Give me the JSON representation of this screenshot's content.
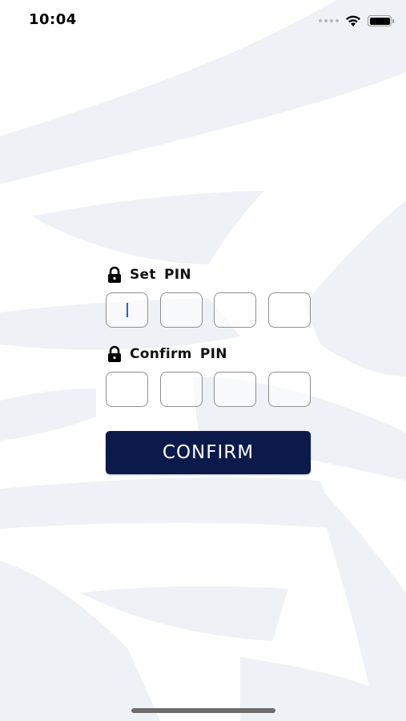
{
  "status_bar": {
    "time": "10:04",
    "icons": [
      "signal-dots-icon",
      "wifi-icon",
      "battery-icon"
    ]
  },
  "form": {
    "set_pin": {
      "icon": "lock-icon",
      "label": "Set  PIN",
      "digits": [
        "",
        "",
        "",
        ""
      ]
    },
    "confirm_pin": {
      "icon": "lock-icon",
      "label": "Confirm  PIN",
      "digits": [
        "",
        "",
        "",
        ""
      ]
    },
    "confirm_button_label": "CONFIRM"
  },
  "colors": {
    "button_bg": "#0c1a4b",
    "caret": "#2f5bd0",
    "background_art": "#eef1f6"
  }
}
